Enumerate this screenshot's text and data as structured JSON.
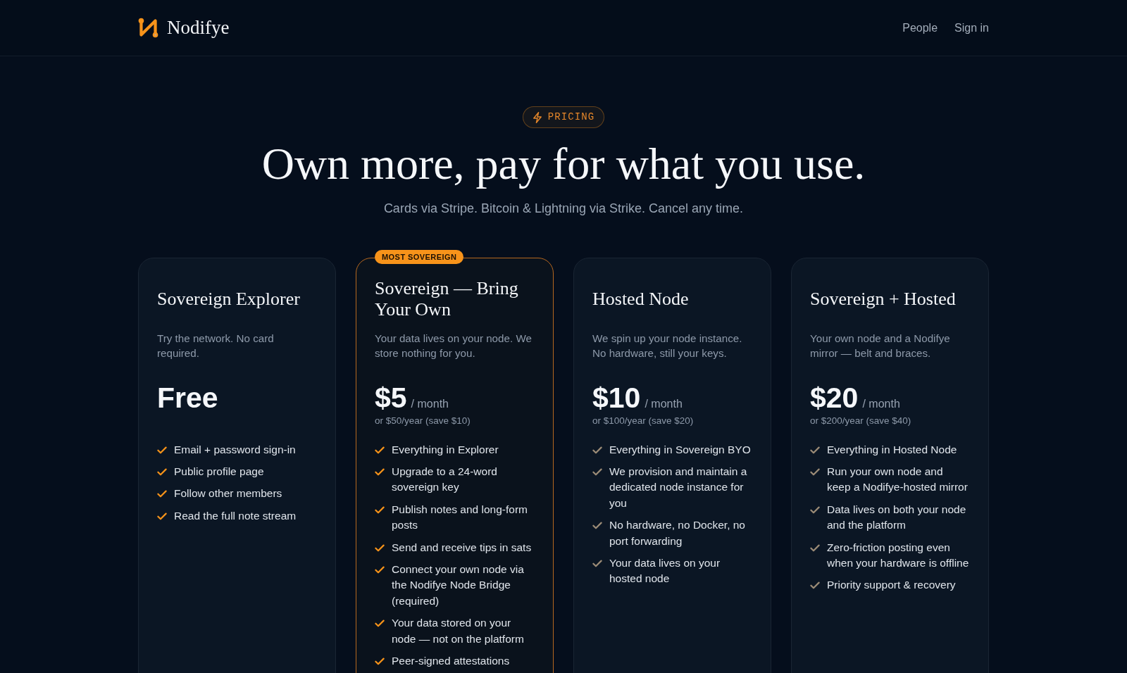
{
  "brand": {
    "name": "Nodifye"
  },
  "nav": {
    "links": [
      {
        "label": "People"
      },
      {
        "label": "Sign in"
      }
    ]
  },
  "hero": {
    "eyebrow": "PRICING",
    "title": "Own more, pay for what you use.",
    "subtitle": "Cards via Stripe. Bitcoin & Lightning via Strike. Cancel any time."
  },
  "plans": [
    {
      "name": "Sovereign Explorer",
      "featured": false,
      "description": "Try the network. No card required.",
      "price": "Free",
      "color": "#f7931a",
      "features": [
        "Email + password sign-in",
        "Public profile page",
        "Follow other members",
        "Read the full note stream"
      ]
    },
    {
      "name": "Sovereign — Bring Your Own",
      "featured": true,
      "ribbon": "MOST SOVEREIGN",
      "description": "Your data lives on your node. We store nothing for you.",
      "price": "$5",
      "period": "/ month",
      "yearly": "or $50/year (save $10)",
      "color": "#f7931a",
      "features": [
        "Everything in Explorer",
        "Upgrade to a 24-word sovereign key",
        "Publish notes and long-form posts",
        "Send and receive tips in sats",
        "Connect your own node via the Nodifye Node Bridge (required)",
        "Your data stored on your node — not on the platform",
        "Peer-signed attestations"
      ]
    },
    {
      "name": "Hosted Node",
      "featured": false,
      "description": "We spin up your node instance. No hardware, still your keys.",
      "price": "$10",
      "period": "/ month",
      "yearly": "or $100/year (save $20)",
      "color": "#9c8c77",
      "features": [
        "Everything in Sovereign BYO",
        "We provision and maintain a dedicated node instance for you",
        "No hardware, no Docker, no port forwarding",
        "Your data lives on your hosted node"
      ]
    },
    {
      "name": "Sovereign + Hosted",
      "featured": false,
      "description": "Your own node and a Nodifye mirror — belt and braces.",
      "price": "$20",
      "period": "/ month",
      "yearly": "or $200/year (save $40)",
      "color": "#9c8c77",
      "features": [
        "Everything in Hosted Node",
        "Run your own node and keep a Nodifye-hosted mirror",
        "Data lives on both your node and the platform",
        "Zero-friction posting even when your hardware is offline",
        "Priority support & recovery"
      ]
    }
  ]
}
